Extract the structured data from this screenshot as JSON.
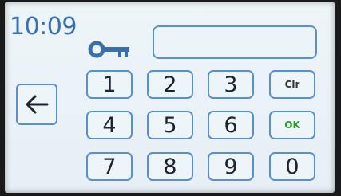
{
  "clock": {
    "time": "10:09"
  },
  "icons": {
    "lock": "key-icon",
    "back": "left-arrow-icon"
  },
  "keypad": {
    "keys": [
      "1",
      "2",
      "3",
      "Clr",
      "4",
      "5",
      "6",
      "OK",
      "7",
      "8",
      "9",
      "0"
    ]
  },
  "colors": {
    "accent": "#5b8fc9",
    "ok": "#2f9a2c",
    "text": "#1d2430",
    "clock": "#3a6fb0"
  }
}
